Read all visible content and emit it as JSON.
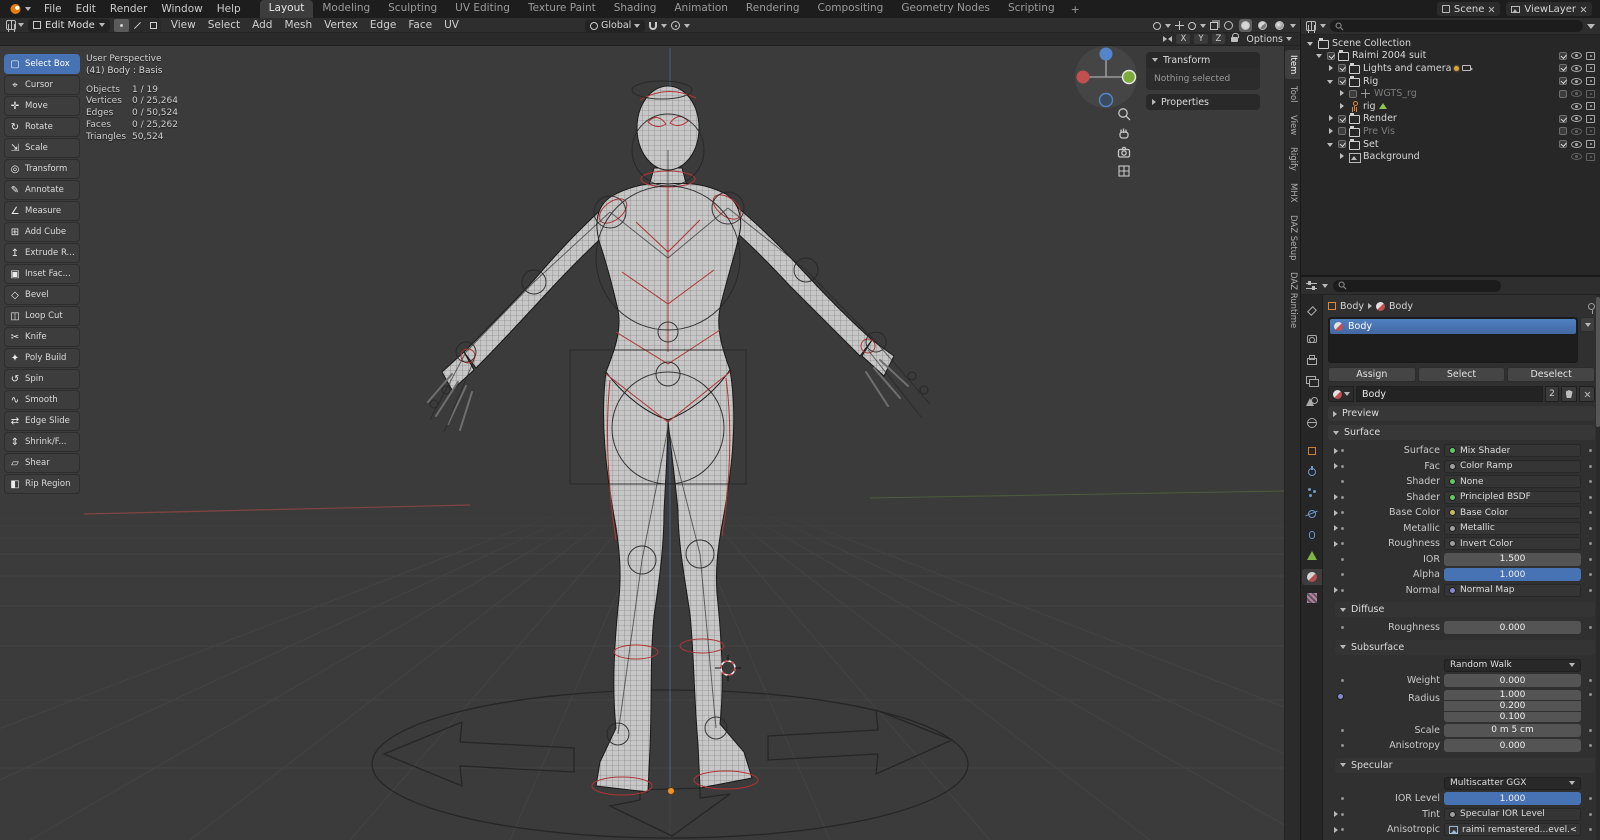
{
  "colors": {
    "accent": "#4772b3",
    "header_bg": "#1d1d1d",
    "viewport_bg": "#3b3b3b",
    "panel_bg": "#303030",
    "seam_red": "#b03535",
    "axis_x": "#9a4848",
    "axis_y": "#5f7d42",
    "axis_z": "#5a7fb5",
    "socket_shader": "#63c763",
    "socket_color": "#c8b85e",
    "socket_float": "#9f9f9f",
    "socket_vector": "#8888d0",
    "object_orange": "#e0883a",
    "mesh_green": "#8cc64a"
  },
  "topbar": {
    "menus": [
      "File",
      "Edit",
      "Render",
      "Window",
      "Help"
    ],
    "workspaces": [
      "Layout",
      "Modeling",
      "Sculpting",
      "UV Editing",
      "Texture Paint",
      "Shading",
      "Animation",
      "Rendering",
      "Compositing",
      "Geometry Nodes",
      "Scripting"
    ],
    "add_workspace": "+",
    "scene": "Scene",
    "view_layer": "ViewLayer"
  },
  "vp_header": {
    "mode": "Edit Mode",
    "menus": [
      "View",
      "Select",
      "Add",
      "Mesh",
      "Vertex",
      "Edge",
      "Face",
      "UV"
    ],
    "orientation": "Global",
    "axis_toggles": [
      "X",
      "Y",
      "Z"
    ],
    "options": "Options"
  },
  "toolbar": [
    {
      "label": "Select Box",
      "icon": "▢"
    },
    {
      "label": "Cursor",
      "icon": "⌖"
    },
    {
      "label": "Move",
      "icon": "✛"
    },
    {
      "label": "Rotate",
      "icon": "↻"
    },
    {
      "label": "Scale",
      "icon": "⇲"
    },
    {
      "label": "Transform",
      "icon": "◎"
    },
    {
      "label": "Annotate",
      "icon": "✎"
    },
    {
      "label": "Measure",
      "icon": "∠"
    },
    {
      "label": "Add Cube",
      "icon": "⊞"
    },
    {
      "label": "Extrude R...",
      "icon": "↥"
    },
    {
      "label": "Inset Fac...",
      "icon": "▣"
    },
    {
      "label": "Bevel",
      "icon": "◇"
    },
    {
      "label": "Loop Cut",
      "icon": "◫"
    },
    {
      "label": "Knife",
      "icon": "✂"
    },
    {
      "label": "Poly Build",
      "icon": "✦"
    },
    {
      "label": "Spin",
      "icon": "↺"
    },
    {
      "label": "Smooth",
      "icon": "∿"
    },
    {
      "label": "Edge Slide",
      "icon": "⇄"
    },
    {
      "label": "Shrink/F...",
      "icon": "⇕"
    },
    {
      "label": "Shear",
      "icon": "▱"
    },
    {
      "label": "Rip Region",
      "icon": "◧"
    }
  ],
  "stats": {
    "view": "User Perspective",
    "object": "(41) Body : Basis",
    "rows": [
      {
        "label": "Objects",
        "value": "1 / 19"
      },
      {
        "label": "Vertices",
        "value": "0 / 25,264"
      },
      {
        "label": "Edges",
        "value": "0 / 50,524"
      },
      {
        "label": "Faces",
        "value": "0 / 25,262"
      },
      {
        "label": "Triangles",
        "value": "50,524"
      }
    ]
  },
  "npanel": {
    "transform_label": "Transform",
    "empty": "Nothing selected",
    "properties_label": "Properties",
    "tabs": [
      "Item",
      "Tool",
      "View",
      "Rigify",
      "MHX",
      "DAZ Setup",
      "DAZ Runtime"
    ]
  },
  "outliner": {
    "rows": [
      {
        "label": "Scene Collection"
      },
      {
        "label": "Raimi 2004 suit"
      },
      {
        "label": "Lights and camera"
      },
      {
        "label": "Rig"
      },
      {
        "label": "WGTS_rg"
      },
      {
        "label": "rig"
      },
      {
        "label": "Render"
      },
      {
        "label": "Pre Vis"
      },
      {
        "label": "Set"
      },
      {
        "label": "Background"
      }
    ]
  },
  "props": {
    "breadcrumb": {
      "object": "Body",
      "material": "Body"
    },
    "slot": "Body",
    "assign": "Assign",
    "select": "Select",
    "deselect": "Deselect",
    "datablock": {
      "name": "Body",
      "users": "2"
    },
    "preview_label": "Preview",
    "surface_label": "Surface",
    "surface_rows": [
      {
        "label": "Surface",
        "value": "Mix Shader"
      },
      {
        "label": "Fac",
        "value": "Color Ramp"
      },
      {
        "label": "Shader",
        "value": "None"
      },
      {
        "label": "Shader",
        "value": "Principled BSDF"
      },
      {
        "label": "Base Color",
        "value": "Base Color"
      },
      {
        "label": "Metallic",
        "value": "Metallic"
      },
      {
        "label": "Roughness",
        "value": "Invert Color"
      },
      {
        "label": "IOR",
        "value": "1.500"
      },
      {
        "label": "Alpha",
        "value": "1.000"
      },
      {
        "label": "Normal",
        "value": "Normal Map"
      }
    ],
    "diffuse_label": "Diffuse",
    "diffuse_roughness": {
      "label": "Roughness",
      "value": "0.000"
    },
    "subsurface_label": "Subsurface",
    "subsurface_method": "Random Walk",
    "weight": {
      "label": "Weight",
      "value": "0.000"
    },
    "radius_label": "Radius",
    "radius_values": [
      "1.000",
      "0.200",
      "0.100"
    ],
    "scale": {
      "label": "Scale",
      "value": "0 m 5 cm"
    },
    "anisotropy": {
      "label": "Anisotropy",
      "value": "0.000"
    },
    "specular_label": "Specular",
    "specular_method": "Multiscatter GGX",
    "ior_level": {
      "label": "IOR Level",
      "value": "1.000"
    },
    "tint": {
      "label": "Tint",
      "value": "Specular IOR Level"
    },
    "anisotropic": {
      "label": "Anisotropic",
      "value": "raimi remastered...evel.<UDIM>.png"
    }
  }
}
